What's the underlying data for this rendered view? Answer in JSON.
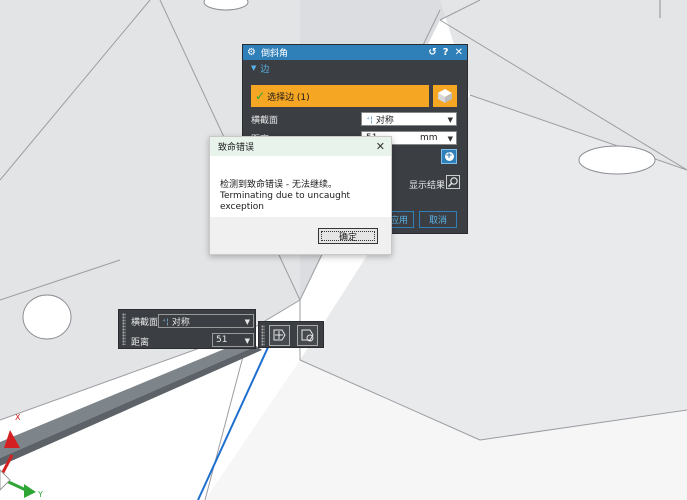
{
  "chamfer_dialog": {
    "title": "倒斜角",
    "reset_glyph": "↺",
    "help_glyph": "?",
    "close_glyph": "✕",
    "section_label": "边",
    "select_edge_label": "选择边 (1)",
    "cross_section_label": "横截面",
    "cross_section_value": "对称",
    "distance_label": "距离",
    "distance_value": "51",
    "distance_unit": "mm",
    "show_result_label": "显示结果",
    "apply_button": "应用",
    "cancel_button": "取消"
  },
  "error_dialog": {
    "title": "致命错误",
    "message_line1": "检测到致命错误 - 无法继续。",
    "message_line2": "Terminating due to uncaught exception",
    "ok_button": "确定"
  },
  "onscreen_input": {
    "cross_section_label": "横截面",
    "cross_section_value": "对称",
    "distance_label": "距离",
    "distance_value": "51"
  },
  "triad": {
    "x_label": "X",
    "y_label": "Y"
  },
  "colors": {
    "titlebar_blue": "#2f7fb8",
    "selection_orange": "#f5a623",
    "panel_dark": "#3b3e43",
    "error_title_bg": "#e8f3ec"
  }
}
